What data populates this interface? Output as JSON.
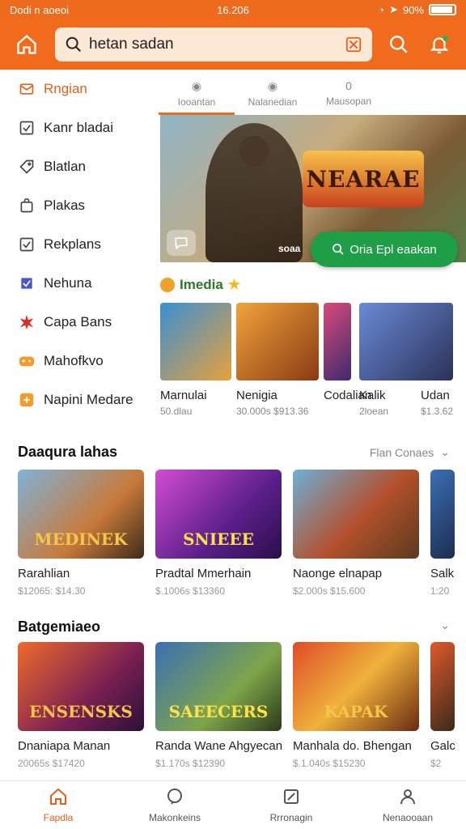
{
  "status": {
    "carrier": "Dodi n aoeoi",
    "time": "16.206",
    "battery": "90%"
  },
  "search": {
    "value": "hetan sadan"
  },
  "sidebar": {
    "items": [
      {
        "label": "Rngian",
        "icon": "mail-icon",
        "active": true
      },
      {
        "label": "Kanr bladai",
        "icon": "checkbox-icon"
      },
      {
        "label": "Blatlan",
        "icon": "tag-icon"
      },
      {
        "label": "Plakas",
        "icon": "bag-icon"
      },
      {
        "label": "Rekplans",
        "icon": "checkbox-icon"
      },
      {
        "label": "Nehuna",
        "icon": "check-square-icon"
      },
      {
        "label": "Capa Bans",
        "icon": "star-burst-icon"
      },
      {
        "label": "Mahofkvo",
        "icon": "gamepad-icon"
      },
      {
        "label": "Napini Medare",
        "icon": "puzzle-icon"
      }
    ]
  },
  "tabs": [
    {
      "label": "Iooantan",
      "glyph": "◉",
      "active": true
    },
    {
      "label": "Nalanedian",
      "glyph": "◉"
    },
    {
      "label": "Mausopan",
      "glyph": "0"
    }
  ],
  "hero": {
    "title": "NEARAE",
    "caption": "soaa",
    "cta": "Oria Epl eaakan"
  },
  "media": {
    "heading": "Imedia",
    "items": [
      {
        "name": "Marnulai",
        "sub": "50.dlau"
      },
      {
        "name": "Nenigia",
        "sub": "30.000s $913.36"
      },
      {
        "name": "Codalian",
        "sub": ""
      },
      {
        "name": "Kalik",
        "sub": "2loean"
      },
      {
        "name": "Udan",
        "sub": "$1.3.62"
      }
    ]
  },
  "section1": {
    "title": "Daaqura lahas",
    "link": "Flan Conaes",
    "cards": [
      {
        "name": "Rarahlian",
        "price": "$12065: $14.30",
        "art": "MEDINEK"
      },
      {
        "name": "Pradtal Mmerhain",
        "price": "$.1006s $13360",
        "art": "SNIEEE"
      },
      {
        "name": "Naonge elnapap",
        "price": "$2.000s $15.600",
        "art": ""
      },
      {
        "name": "Salk",
        "price": "1:20",
        "art": ""
      }
    ]
  },
  "section2": {
    "title": "Batgemiaeo",
    "cards": [
      {
        "name": "Dnaniapa Manan",
        "price": "20065s $17420",
        "art": "ENSENSKS"
      },
      {
        "name": "Randa Wane Ahgyecan",
        "price": "$1.170s $12390",
        "art": "SAEECERS"
      },
      {
        "name": "Manhala do. Bhengan",
        "price": "$.1.040s $15230",
        "art": "KAPAK"
      },
      {
        "name": "Galc",
        "price": "$2",
        "art": ""
      }
    ]
  },
  "bottomnav": [
    {
      "label": "Fapdla",
      "icon": "home-icon",
      "active": true
    },
    {
      "label": "Makonkeins",
      "icon": "chat-icon"
    },
    {
      "label": "Rrronagin",
      "icon": "edit-icon"
    },
    {
      "label": "Nenaooaan",
      "icon": "user-icon"
    }
  ],
  "colors": {
    "accent": "#f06b1b",
    "cta": "#1e9e47"
  }
}
